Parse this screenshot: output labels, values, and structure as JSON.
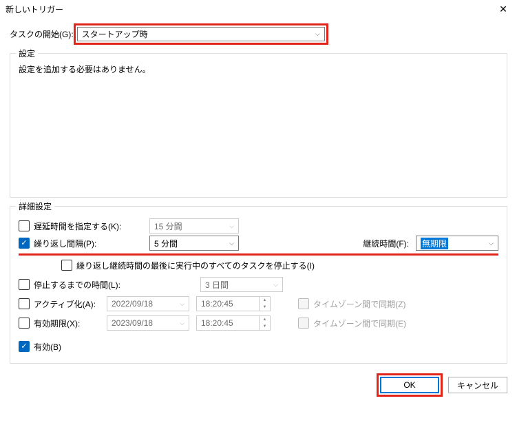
{
  "window": {
    "title": "新しいトリガー",
    "close_aria": "Close"
  },
  "begin_task": {
    "label": "タスクの開始(G):",
    "value": "スタートアップ時"
  },
  "settings_group": {
    "legend": "設定",
    "message": "設定を追加する必要はありません。"
  },
  "advanced": {
    "legend": "詳細設定",
    "delay": {
      "label": "遅延時間を指定する(K):",
      "value": "15 分間",
      "checked": false
    },
    "repeat": {
      "label": "繰り返し間隔(P):",
      "value": "5 分間",
      "checked": true,
      "duration_label": "継続時間(F):",
      "duration_value": "無期限"
    },
    "stop_all": {
      "label": "繰り返し継続時間の最後に実行中のすべてのタスクを停止する(I)",
      "checked": false
    },
    "stop_after": {
      "label": "停止するまでの時間(L):",
      "value": "3 日間",
      "checked": false
    },
    "activate": {
      "label": "アクティブ化(A):",
      "date": "2022/09/18",
      "time": "18:20:45",
      "sync_label": "タイムゾーン間で同期(Z)",
      "checked": false
    },
    "expire": {
      "label": "有効期限(X):",
      "date": "2023/09/18",
      "time": "18:20:45",
      "sync_label": "タイムゾーン間で同期(E)",
      "checked": false
    },
    "enabled": {
      "label": "有効(B)",
      "checked": true
    }
  },
  "buttons": {
    "ok": "OK",
    "cancel": "キャンセル"
  }
}
